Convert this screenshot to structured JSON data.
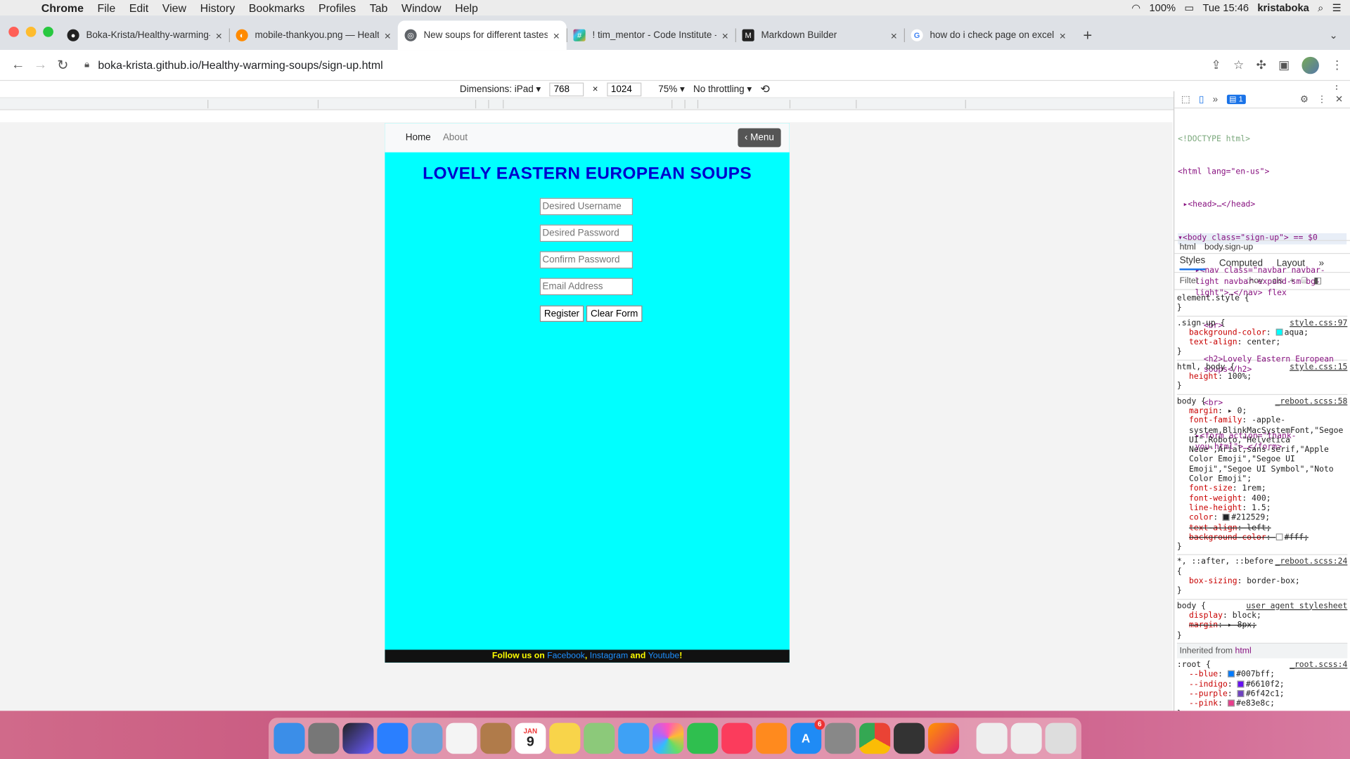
{
  "menubar": {
    "app": "Chrome",
    "items": [
      "File",
      "Edit",
      "View",
      "History",
      "Bookmarks",
      "Profiles",
      "Tab",
      "Window",
      "Help"
    ],
    "battery": "100%",
    "clock": "Tue 15:46",
    "user": "kristaboka"
  },
  "tabs": [
    {
      "label": "Boka-Krista/Healthy-warming-",
      "icon": "github-icon"
    },
    {
      "label": "mobile-thankyou.png — Healt",
      "icon": "gitpod-icon"
    },
    {
      "label": "New soups for different tastes",
      "icon": "globe-icon",
      "active": true
    },
    {
      "label": "! tim_mentor - Code Institute -",
      "icon": "slack-icon"
    },
    {
      "label": "Markdown Builder",
      "icon": "markdown-icon"
    },
    {
      "label": "how do i check page on excel o",
      "icon": "google-icon"
    }
  ],
  "address_bar": {
    "url": "boka-krista.github.io/Healthy-warming-soups/sign-up.html"
  },
  "device_toolbar": {
    "dimensions_label": "Dimensions: iPad",
    "width": "768",
    "height": "1024",
    "zoom": "75%",
    "throttle": "No throttling"
  },
  "site": {
    "nav": {
      "home": "Home",
      "about": "About",
      "menu": "‹ Menu"
    },
    "title": "LOVELY EASTERN EUROPEAN SOUPS",
    "form": {
      "username_placeholder": "Desired Username",
      "password_placeholder": "Desired Password",
      "confirm_placeholder": "Confirm Password",
      "email_placeholder": "Email Address",
      "register": "Register",
      "clear": "Clear Form"
    },
    "footer": {
      "prefix": "Follow us on ",
      "facebook": "Facebook",
      "comma": ", ",
      "instagram": "Instagram",
      "and": " and ",
      "youtube": "Youtube",
      "suffix": "!"
    }
  },
  "devtools": {
    "issues_count": "1",
    "elements": [
      "<!DOCTYPE html>",
      "<html lang=\"en-us\">",
      "▸<head>…</head>",
      "▾<body class=\"sign-up\"> == $0",
      "▸<nav class=\"navbar navbar-light navbar-expand-sm bg-light\">…</nav> flex",
      "<br>",
      "<h2>Lovely Eastern European soups</h2>",
      "<br>",
      "▸<form action=\"thank-you.html\">…</form>"
    ],
    "crumbs": [
      "html",
      "body.sign-up"
    ],
    "tabs": [
      "Styles",
      "Computed",
      "Layout"
    ],
    "filter_placeholder": "Filter",
    "filter_tools": [
      ":hov",
      ".cls"
    ],
    "rules": [
      {
        "selector": "element.style {",
        "src": "",
        "props": []
      },
      {
        "selector": ".sign-up {",
        "src": "style.css:97",
        "props": [
          {
            "n": "background-color",
            "v": "aqua;",
            "swatch": "#00ffff"
          },
          {
            "n": "text-align",
            "v": "center;"
          }
        ]
      },
      {
        "selector": "html, body {",
        "src": "style.css:15",
        "props": [
          {
            "n": "height",
            "v": "100%;"
          }
        ]
      },
      {
        "selector": "body {",
        "src": "_reboot.scss:58",
        "props": [
          {
            "n": "margin",
            "v": "▸ 0;"
          },
          {
            "n": "font-family",
            "v": "-apple-system,BlinkMacSystemFont,\"Segoe UI\",Roboto,\"Helvetica Neue\",Arial,sans-serif,\"Apple Color Emoji\",\"Segoe UI Emoji\",\"Segoe UI Symbol\",\"Noto Color Emoji\";"
          },
          {
            "n": "font-size",
            "v": "1rem;"
          },
          {
            "n": "font-weight",
            "v": "400;"
          },
          {
            "n": "line-height",
            "v": "1.5;"
          },
          {
            "n": "color",
            "v": "#212529;",
            "swatch": "#212529"
          },
          {
            "n": "text-align",
            "v": "left;",
            "strike": true
          },
          {
            "n": "background-color",
            "v": "#fff;",
            "swatch": "#ffffff",
            "strike": true
          }
        ]
      },
      {
        "selector": "*, ::after, ::before {",
        "src": "_reboot.scss:24",
        "props": [
          {
            "n": "box-sizing",
            "v": "border-box;"
          }
        ]
      },
      {
        "selector": "body {",
        "src": "user agent stylesheet",
        "props": [
          {
            "n": "display",
            "v": "block;"
          },
          {
            "n": "margin",
            "v": "▸ 8px;",
            "strike": true
          }
        ]
      }
    ],
    "inherited_label": "Inherited from",
    "inherited_tag": "html",
    "root_rule": {
      "selector": ":root {",
      "src": "_root.scss:4",
      "props": [
        {
          "n": "--blue",
          "v": "#007bff;",
          "swatch": "#007bff"
        },
        {
          "n": "--indigo",
          "v": "#6610f2;",
          "swatch": "#6610f2"
        },
        {
          "n": "--purple",
          "v": "#6f42c1;",
          "swatch": "#6f42c1"
        },
        {
          "n": "--pink",
          "v": "#e83e8c;",
          "swatch": "#e83e8c"
        }
      ]
    }
  },
  "dock": {
    "apps": [
      "finder",
      "launchpad",
      "siri",
      "safari",
      "preview",
      "reminders",
      "notes-brown",
      "calendar",
      "notes",
      "maps",
      "messages",
      "photos",
      "facetime",
      "music",
      "books",
      "app-store",
      "system-preferences",
      "chrome",
      "terminal",
      "firefox"
    ],
    "calendar_day": "9",
    "calendar_month": "JAN",
    "app_store_badge": "6"
  }
}
